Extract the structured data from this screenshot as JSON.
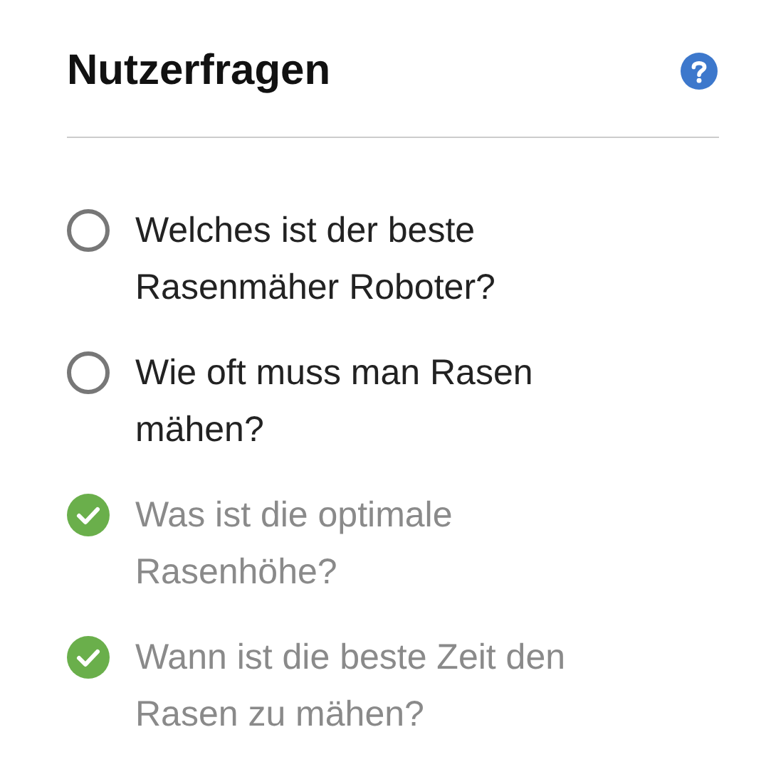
{
  "panel": {
    "title": "Nutzerfragen"
  },
  "questions": [
    {
      "text": "Welches ist der beste Rasenmäher Roboter?",
      "checked": false
    },
    {
      "text": "Wie oft muss man Rasen mähen?",
      "checked": false
    },
    {
      "text": "Was ist die optimale Rasenhöhe?",
      "checked": true
    },
    {
      "text": "Wann ist die beste Zeit den Rasen zu mähen?",
      "checked": true
    }
  ]
}
